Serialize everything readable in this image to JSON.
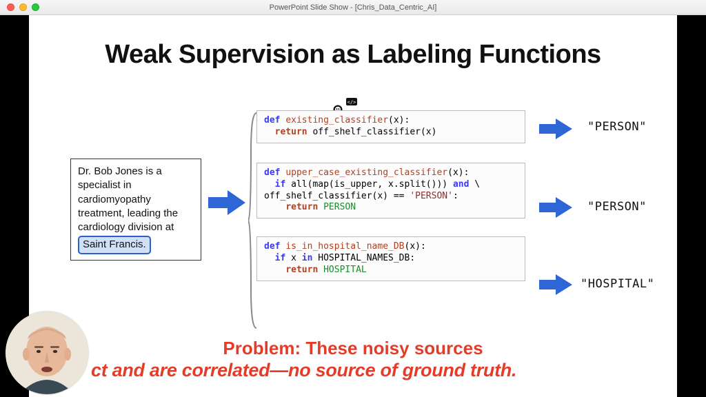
{
  "window": {
    "title": "PowerPoint Slide Show - [Chris_Data_Centric_AI]"
  },
  "slide": {
    "title": "Weak Supervision as Labeling Functions",
    "example_prefix": "Dr. Bob Jones is a specialist in cardiomyopathy treatment, leading the cardiology division at",
    "example_highlight": "Saint Francis.",
    "code": {
      "box1": {
        "l1": "def existing_classifier(x):",
        "l2": "  return off_shelf_classifier(x)"
      },
      "box2": {
        "l1": "def upper_case_existing_classifier(x):",
        "l2": "  if all(map(is_upper, x.split())) and \\",
        "l3": "off_shelf_classifier(x) == 'PERSON':",
        "l4": "    return PERSON"
      },
      "box3": {
        "l1": "def is_in_hospital_name_DB(x):",
        "l2": "  if x in HOSPITAL_NAMES_DB:",
        "l3": "    return HOSPITAL"
      }
    },
    "outputs": {
      "o1": "\"PERSON\"",
      "o2": "\"PERSON\"",
      "o3": "\"HOSPITAL\""
    },
    "problem": {
      "line1": "Problem: These noisy sources",
      "line2": "ct and are correlated—no source of ground truth."
    }
  },
  "colors": {
    "arrow_blue": "#2f66d6",
    "problem_red": "#e53c2a"
  }
}
